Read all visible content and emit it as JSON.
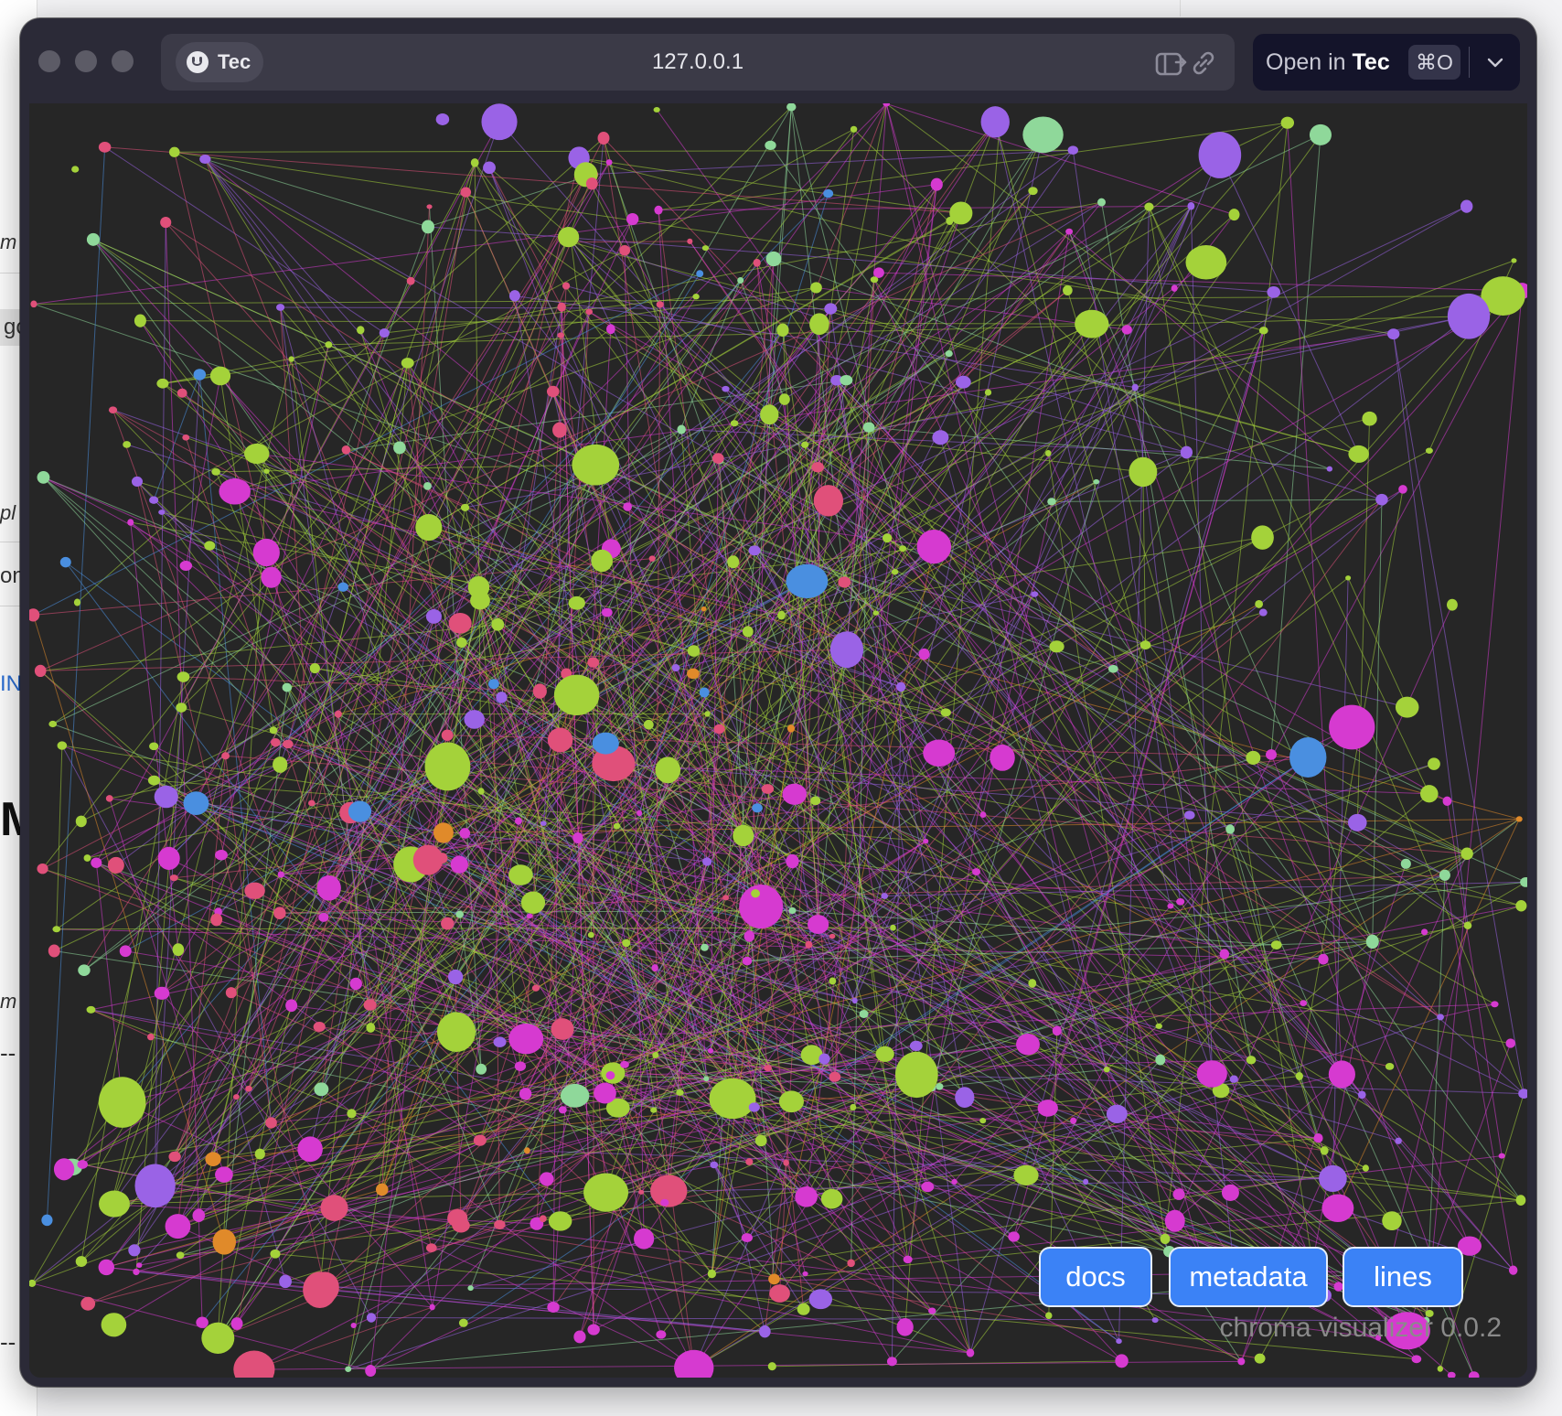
{
  "browser": {
    "profile_label": "Tec",
    "url": "127.0.0.1",
    "open_in": {
      "prefix": "Open in",
      "app": "Tec",
      "shortcut": "⌘O"
    },
    "icons": [
      "profile-smile-icon",
      "share-window-icon",
      "copy-link-icon",
      "chevron-down-icon"
    ]
  },
  "background_page": {
    "fragments": [
      "m",
      "gc",
      "pl",
      "on",
      "IN",
      "M",
      "m",
      "--",
      "--"
    ]
  },
  "app": {
    "buttons": {
      "docs": "docs",
      "metadata": "metadata",
      "lines": "lines"
    },
    "version": "chroma visualizer 0.0.2",
    "colors": {
      "background": "#262626",
      "button": "#3b82f6",
      "palette": [
        "#a4d23a",
        "#d63ad0",
        "#e0507a",
        "#9a63e6",
        "#8fd89a",
        "#e08a2a",
        "#4a8fe0"
      ]
    }
  }
}
